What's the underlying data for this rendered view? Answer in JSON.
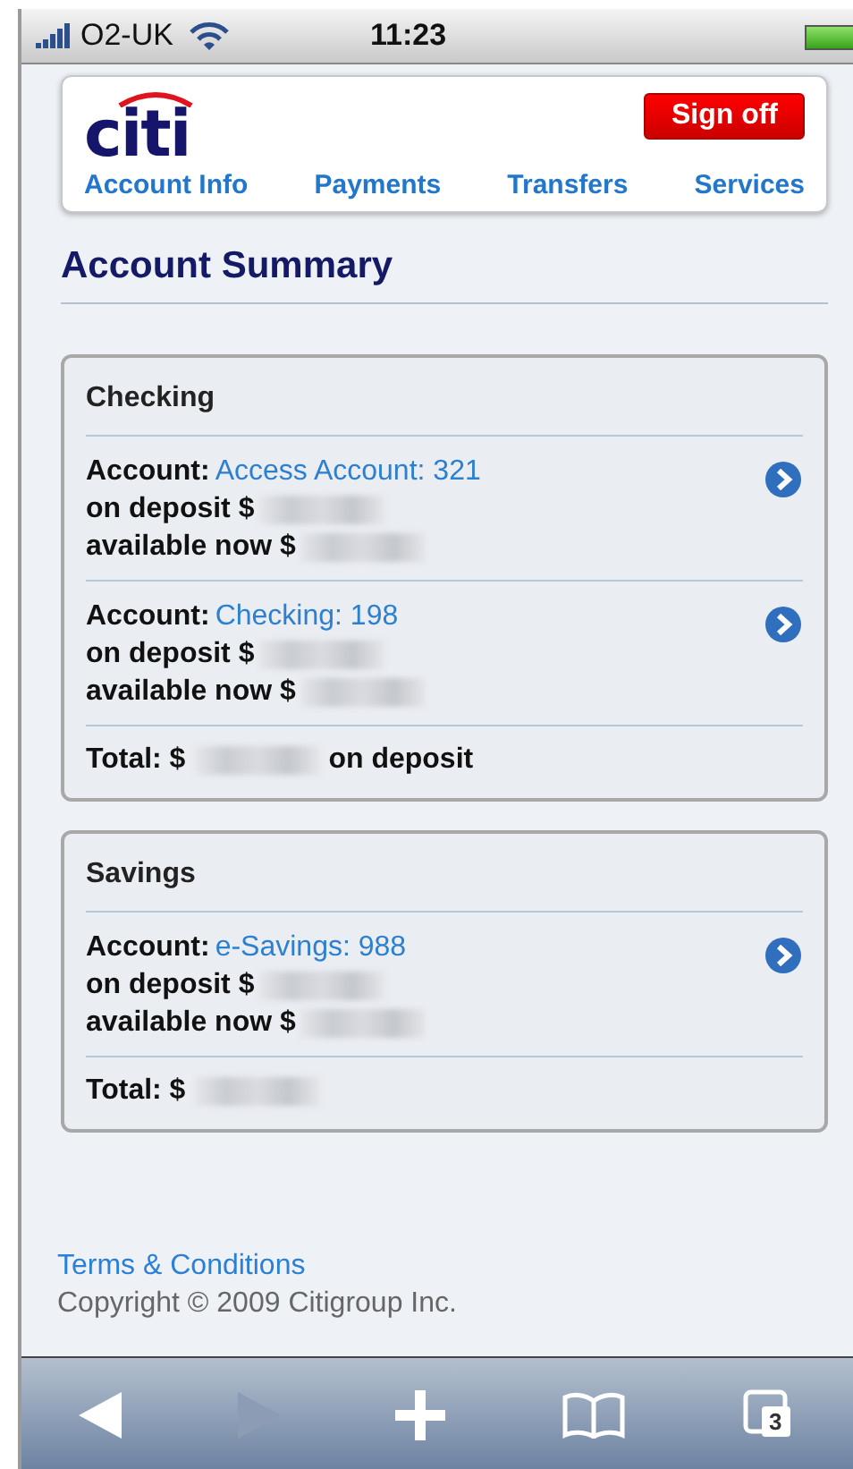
{
  "status_bar": {
    "carrier": "O2-UK",
    "time": "11:23"
  },
  "header": {
    "logo": "citi",
    "sign_off": "Sign off",
    "nav": [
      "Account Info",
      "Payments",
      "Transfers",
      "Services"
    ]
  },
  "title": "Account Summary",
  "groups": [
    {
      "name": "Checking",
      "accounts": [
        {
          "label": "Account:",
          "name": "Access Account: 321",
          "deposit_label": "on deposit $",
          "available_label": "available now $"
        },
        {
          "label": "Account:",
          "name": "Checking: 198",
          "deposit_label": "on deposit $",
          "available_label": "available now $"
        }
      ],
      "total_label": "Total:  $",
      "total_suffix": "on deposit"
    },
    {
      "name": "Savings",
      "accounts": [
        {
          "label": "Account:",
          "name": "e-Savings: 988",
          "deposit_label": "on deposit $",
          "available_label": "available now $"
        }
      ],
      "total_label": "Total:  $"
    }
  ],
  "footer": {
    "link": "Terms & Conditions",
    "copyright": "Copyright © 2009 Citigroup Inc."
  },
  "toolbar": [
    {
      "kind": "back",
      "disabled": false
    },
    {
      "kind": "forward",
      "disabled": true
    },
    {
      "kind": "add",
      "disabled": false
    },
    {
      "kind": "bookmarks",
      "disabled": false
    },
    {
      "kind": "pages",
      "disabled": false,
      "count": "3"
    }
  ]
}
